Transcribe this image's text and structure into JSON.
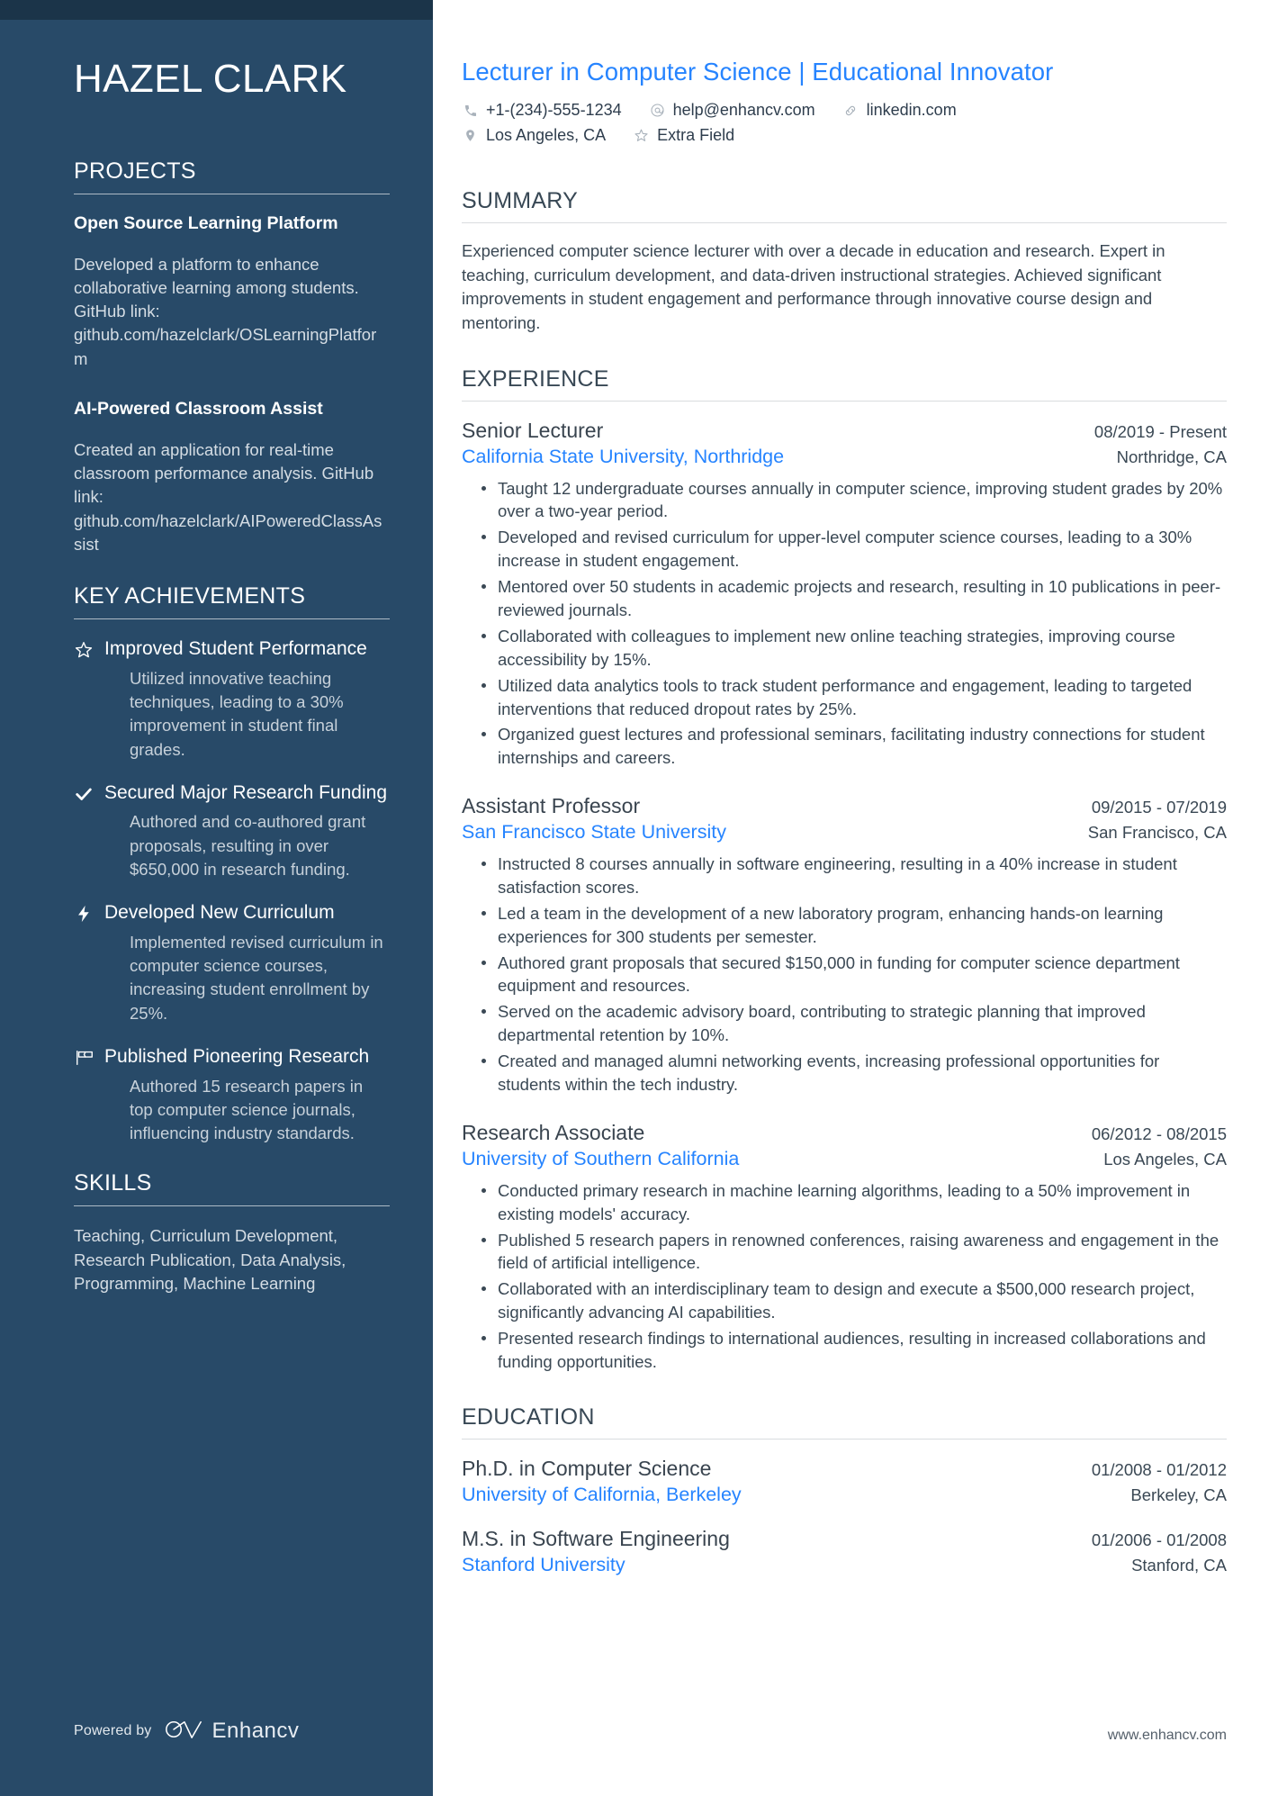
{
  "sidebar": {
    "name": "HAZEL CLARK",
    "projects": {
      "title": "PROJECTS",
      "items": [
        {
          "name": "Open Source Learning Platform",
          "description": "Developed a platform to enhance collaborative learning among students. GitHub link: github.com/hazelclark/OSLearningPlatform"
        },
        {
          "name": "AI-Powered Classroom Assist",
          "description": "Created an application for real-time classroom performance analysis. GitHub link: github.com/hazelclark/AIPoweredClassAssist"
        }
      ]
    },
    "achievements": {
      "title": "KEY ACHIEVEMENTS",
      "items": [
        {
          "icon": "star-outline-icon",
          "title": "Improved Student Performance",
          "description": "Utilized innovative teaching techniques, leading to a 30% improvement in student final grades."
        },
        {
          "icon": "check-icon",
          "title": "Secured Major Research Funding",
          "description": "Authored and co-authored grant proposals, resulting in over $650,000 in research funding."
        },
        {
          "icon": "lightning-bolt-icon",
          "title": "Developed New Curriculum",
          "description": "Implemented revised curriculum in computer science courses, increasing student enrollment by 25%."
        },
        {
          "icon": "flag-outline-icon",
          "title": "Published Pioneering Research",
          "description": "Authored 15 research papers in top computer science journals, influencing industry standards."
        }
      ]
    },
    "skills": {
      "title": "SKILLS",
      "text": "Teaching, Curriculum Development, Research Publication, Data Analysis, Programming, Machine Learning"
    },
    "footer": {
      "powered_by": "Powered by",
      "brand": "Enhancv"
    }
  },
  "main": {
    "headline": "Lecturer in Computer Science | Educational Innovator",
    "contacts": [
      {
        "icon": "phone-icon",
        "value": "+1-(234)-555-1234"
      },
      {
        "icon": "email-icon",
        "value": "help@enhancv.com"
      },
      {
        "icon": "link-icon",
        "value": "linkedin.com"
      },
      {
        "icon": "location-pin-icon",
        "value": "Los Angeles, CA"
      },
      {
        "icon": "star-outline-icon",
        "value": "Extra Field"
      }
    ],
    "summary": {
      "title": "SUMMARY",
      "text": "Experienced computer science lecturer with over a decade in education and research. Expert in teaching, curriculum development, and data-driven instructional strategies. Achieved significant improvements in student engagement and performance through innovative course design and mentoring."
    },
    "experience": {
      "title": "EXPERIENCE",
      "entries": [
        {
          "role": "Senior Lecturer",
          "dates": "08/2019 - Present",
          "company": "California State University, Northridge",
          "location": "Northridge, CA",
          "bullets": [
            "Taught 12 undergraduate courses annually in computer science, improving student grades by 20% over a two-year period.",
            "Developed and revised curriculum for upper-level computer science courses, leading to a 30% increase in student engagement.",
            "Mentored over 50 students in academic projects and research, resulting in 10 publications in peer-reviewed journals.",
            "Collaborated with colleagues to implement new online teaching strategies, improving course accessibility by 15%.",
            "Utilized data analytics tools to track student performance and engagement, leading to targeted interventions that reduced dropout rates by 25%.",
            "Organized guest lectures and professional seminars, facilitating industry connections for student internships and careers."
          ]
        },
        {
          "role": "Assistant Professor",
          "dates": "09/2015 - 07/2019",
          "company": "San Francisco State University",
          "location": "San Francisco, CA",
          "bullets": [
            "Instructed 8 courses annually in software engineering, resulting in a 40% increase in student satisfaction scores.",
            "Led a team in the development of a new laboratory program, enhancing hands-on learning experiences for 300 students per semester.",
            "Authored grant proposals that secured $150,000 in funding for computer science department equipment and resources.",
            "Served on the academic advisory board, contributing to strategic planning that improved departmental retention by 10%.",
            "Created and managed alumni networking events, increasing professional opportunities for students within the tech industry."
          ]
        },
        {
          "role": "Research Associate",
          "dates": "06/2012 - 08/2015",
          "company": "University of Southern California",
          "location": "Los Angeles, CA",
          "bullets": [
            "Conducted primary research in machine learning algorithms, leading to a 50% improvement in existing models' accuracy.",
            "Published 5 research papers in renowned conferences, raising awareness and engagement in the field of artificial intelligence.",
            "Collaborated with an interdisciplinary team to design and execute a $500,000 research project, significantly advancing AI capabilities.",
            "Presented research findings to international audiences, resulting in increased collaborations and funding opportunities."
          ]
        }
      ]
    },
    "education": {
      "title": "EDUCATION",
      "entries": [
        {
          "degree": "Ph.D. in Computer Science",
          "dates": "01/2008 - 01/2012",
          "school": "University of California, Berkeley",
          "location": "Berkeley, CA"
        },
        {
          "degree": "M.S. in Software Engineering",
          "dates": "01/2006 - 01/2008",
          "school": "Stanford University",
          "location": "Stanford, CA"
        }
      ]
    },
    "footer": {
      "website": "www.enhancv.com"
    }
  },
  "colors": {
    "sidebar_bg": "#284A68",
    "sidebar_top_strip": "#1B3449",
    "accent_blue": "#2684FF",
    "body_text": "#3A4854"
  }
}
